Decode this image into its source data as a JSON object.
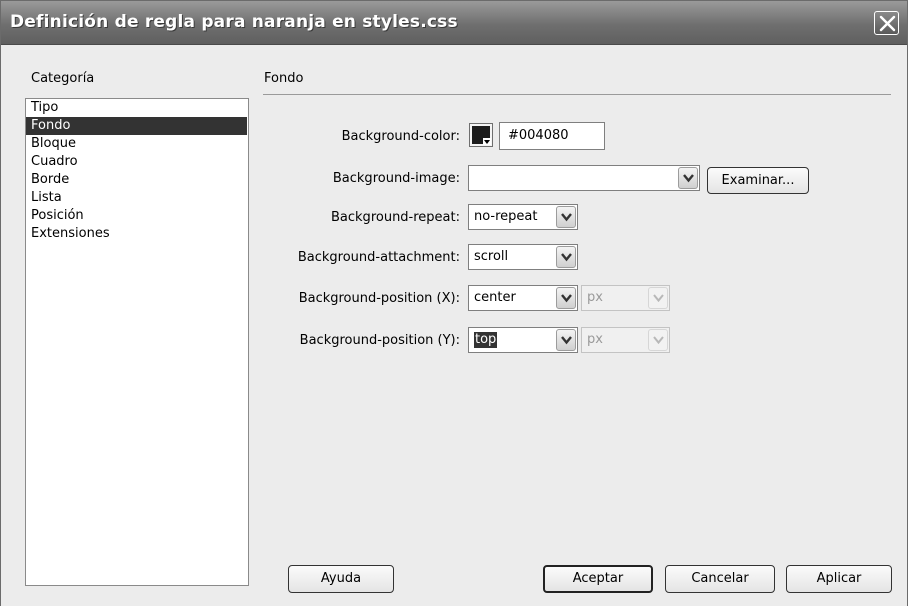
{
  "window": {
    "title": "Definición de regla para naranja en styles.css"
  },
  "category": {
    "header": "Categoría",
    "items": [
      "Tipo",
      "Fondo",
      "Bloque",
      "Cuadro",
      "Borde",
      "Lista",
      "Posición",
      "Extensiones"
    ],
    "selected": "Fondo"
  },
  "section": {
    "title": "Fondo"
  },
  "fields": {
    "bg_color": {
      "label": "Background-color:",
      "value": "#004080",
      "swatch_color": "#1c1c1c"
    },
    "bg_image": {
      "label": "Background-image:",
      "value": "",
      "browse_label": "Examinar..."
    },
    "bg_repeat": {
      "label": "Background-repeat:",
      "value": "no-repeat"
    },
    "bg_attachment": {
      "label": "Background-attachment:",
      "value": "scroll"
    },
    "bg_pos_x": {
      "label": "Background-position (X):",
      "value": "center",
      "unit": "px"
    },
    "bg_pos_y": {
      "label": "Background-position (Y):",
      "value": "top",
      "unit": "px"
    }
  },
  "buttons": {
    "help": "Ayuda",
    "ok": "Aceptar",
    "cancel": "Cancelar",
    "apply": "Aplicar"
  },
  "icons": {
    "close": "close-icon",
    "dropdown": "chevron-down-icon"
  }
}
